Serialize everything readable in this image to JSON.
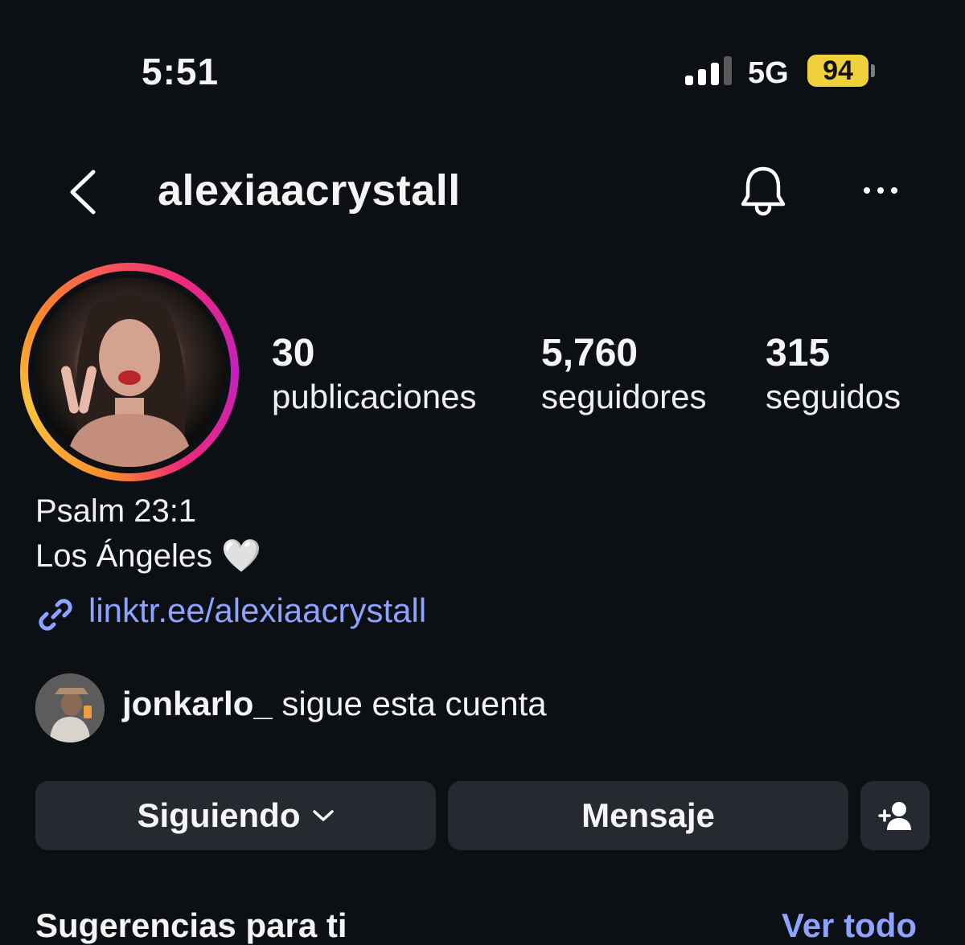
{
  "status_bar": {
    "time": "5:51",
    "network": "5G",
    "battery": "94"
  },
  "header": {
    "username": "alexiaacrystall"
  },
  "stats": [
    {
      "value": "30",
      "label": "publicaciones"
    },
    {
      "value": "5,760",
      "label": "seguidores"
    },
    {
      "value": "315",
      "label": "seguidos"
    }
  ],
  "bio": {
    "line1": "Psalm 23:1",
    "line2": "Los Ángeles",
    "emoji": "🤍",
    "link": "linktr.ee/alexiaacrystall"
  },
  "followed_by": {
    "username": "jonkarlo_",
    "text": " sigue esta cuenta"
  },
  "buttons": {
    "following": "Siguiendo",
    "message": "Mensaje"
  },
  "suggestions": {
    "title": "Sugerencias para ti",
    "see_all": "Ver todo"
  },
  "colors": {
    "background": "#0c0f14",
    "button": "#262a30",
    "link": "#8ea3ff",
    "battery": "#f1d13b"
  },
  "icons": [
    "back-icon",
    "bell-icon",
    "more-icon",
    "link-icon",
    "chevron-down-icon",
    "add-user-icon",
    "signal-icon"
  ]
}
